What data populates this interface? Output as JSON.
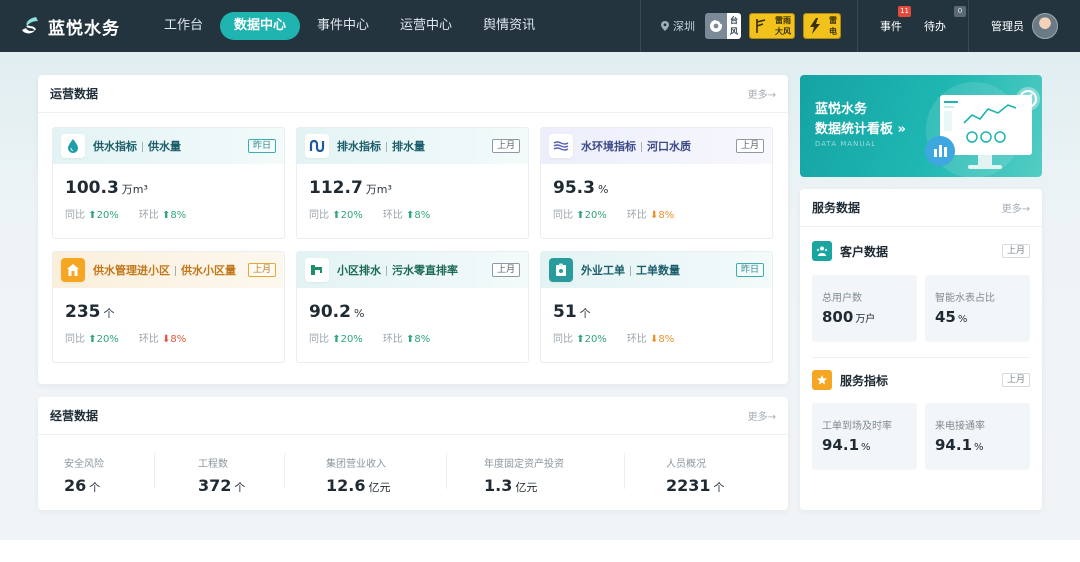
{
  "nav": {
    "brand": "蓝悦水务",
    "items": [
      {
        "label": "工作台",
        "active": false
      },
      {
        "label": "数据中心",
        "active": true
      },
      {
        "label": "事件中心",
        "active": false
      },
      {
        "label": "运营中心",
        "active": false
      },
      {
        "label": "舆情资讯",
        "active": false
      }
    ],
    "location": "深圳",
    "alerts": [
      {
        "type": "typhoon",
        "line1": "台",
        "line2": "风"
      },
      {
        "type": "rain",
        "line1": "雷雨",
        "line2": "大风"
      },
      {
        "type": "thunder",
        "line1": "雷",
        "line2": "电"
      }
    ],
    "events_label": "事件",
    "events_count": "11",
    "todo_label": "待办",
    "todo_count": "0",
    "user": "管理员"
  },
  "ops": {
    "title": "运营数据",
    "more": "更多→",
    "cards": [
      {
        "name": "供水指标",
        "sub": "供水量",
        "tag": "昨日",
        "value": "100.3",
        "unit": "万m³",
        "yoy_label": "同比",
        "yoy": "20%",
        "yoy_dir": "up",
        "mom_label": "环比",
        "mom": "8%",
        "mom_dir": "up",
        "icon": "water-drop-icon"
      },
      {
        "name": "排水指标",
        "sub": "排水量",
        "tag": "上月",
        "value": "112.7",
        "unit": "万m³",
        "yoy_label": "同比",
        "yoy": "20%",
        "yoy_dir": "up",
        "mom_label": "环比",
        "mom": "8%",
        "mom_dir": "up",
        "icon": "drain-pipe-icon"
      },
      {
        "name": "水环境指标",
        "sub": "河口水质",
        "tag": "上月",
        "value": "95.3",
        "unit": "%",
        "yoy_label": "同比",
        "yoy": "20%",
        "yoy_dir": "up",
        "mom_label": "环比",
        "mom": "8%",
        "mom_dir": "down",
        "icon": "waves-icon"
      },
      {
        "name": "供水管理进小区",
        "sub": "供水小区量",
        "tag": "上月",
        "value": "235",
        "unit": "个",
        "yoy_label": "同比",
        "yoy": "20%",
        "yoy_dir": "up",
        "mom_label": "环比",
        "mom": "8%",
        "mom_dir": "down",
        "icon": "house-icon"
      },
      {
        "name": "小区排水",
        "sub": "污水零直排率",
        "tag": "上月",
        "value": "90.2",
        "unit": "%",
        "yoy_label": "同比",
        "yoy": "20%",
        "yoy_dir": "up",
        "mom_label": "环比",
        "mom": "8%",
        "mom_dir": "up",
        "icon": "faucet-icon"
      },
      {
        "name": "外业工单",
        "sub": "工单数量",
        "tag": "昨日",
        "value": "51",
        "unit": "个",
        "yoy_label": "同比",
        "yoy": "20%",
        "yoy_dir": "up",
        "mom_label": "环比",
        "mom": "8%",
        "mom_dir": "down",
        "icon": "work-order-icon"
      }
    ]
  },
  "biz": {
    "title": "经营数据",
    "more": "更多→",
    "items": [
      {
        "label": "安全风险",
        "value": "26",
        "unit": "个"
      },
      {
        "label": "工程数",
        "value": "372",
        "unit": "个"
      },
      {
        "label": "集团营业收入",
        "value": "12.6",
        "unit": "亿元"
      },
      {
        "label": "年度固定资产投资",
        "value": "1.3",
        "unit": "亿元"
      },
      {
        "label": "人员概况",
        "value": "2231",
        "unit": "个"
      }
    ]
  },
  "banner": {
    "line1": "蓝悦水务",
    "line2": "数据统计看板 »",
    "line3": "DATA MANUAL"
  },
  "service": {
    "title": "服务数据",
    "more": "更多→",
    "customer": {
      "title": "客户数据",
      "tag": "上月",
      "items": [
        {
          "label": "总用户数",
          "value": "800",
          "unit": "万户"
        },
        {
          "label": "智能水表占比",
          "value": "45",
          "unit": "%"
        }
      ]
    },
    "indicator": {
      "title": "服务指标",
      "tag": "上月",
      "items": [
        {
          "label": "工单到场及时率",
          "value": "94.1",
          "unit": "%"
        },
        {
          "label": "来电接通率",
          "value": "94.1",
          "unit": "%"
        }
      ]
    }
  },
  "colors": {
    "accent": "#1fb4b0",
    "nav_bg": "#24343f",
    "up": "#2fa57c",
    "down": "#e8932e"
  }
}
